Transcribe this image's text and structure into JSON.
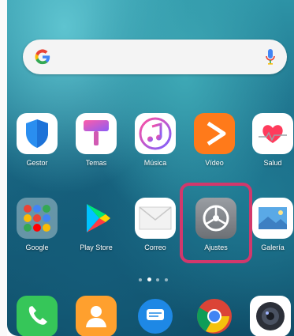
{
  "search": {
    "logo_icon": "google-g-icon",
    "mic_icon": "microphone-icon"
  },
  "apps_row1": [
    {
      "label": "Gestor",
      "icon": "shield-icon"
    },
    {
      "label": "Temas",
      "icon": "paintbrush-icon"
    },
    {
      "label": "Música",
      "icon": "music-note-icon"
    },
    {
      "label": "Vídeo",
      "icon": "play-icon"
    },
    {
      "label": "Salud",
      "icon": "heart-icon"
    }
  ],
  "apps_row2": [
    {
      "label": "Google",
      "icon": "folder-icon"
    },
    {
      "label": "Play Store",
      "icon": "play-store-icon"
    },
    {
      "label": "Correo",
      "icon": "envelope-icon"
    },
    {
      "label": "Ajustes",
      "icon": "gear-icon"
    },
    {
      "label": "Galería",
      "icon": "gallery-icon"
    }
  ],
  "page_indicator": {
    "count": 4,
    "active_index": 1
  },
  "dock": [
    {
      "icon": "phone-icon"
    },
    {
      "icon": "contacts-icon"
    },
    {
      "icon": "messages-icon"
    },
    {
      "icon": "chrome-icon"
    },
    {
      "icon": "camera-icon"
    }
  ],
  "colors": {
    "highlight": "#d2386c",
    "wallpaper": "#1b6a86"
  }
}
